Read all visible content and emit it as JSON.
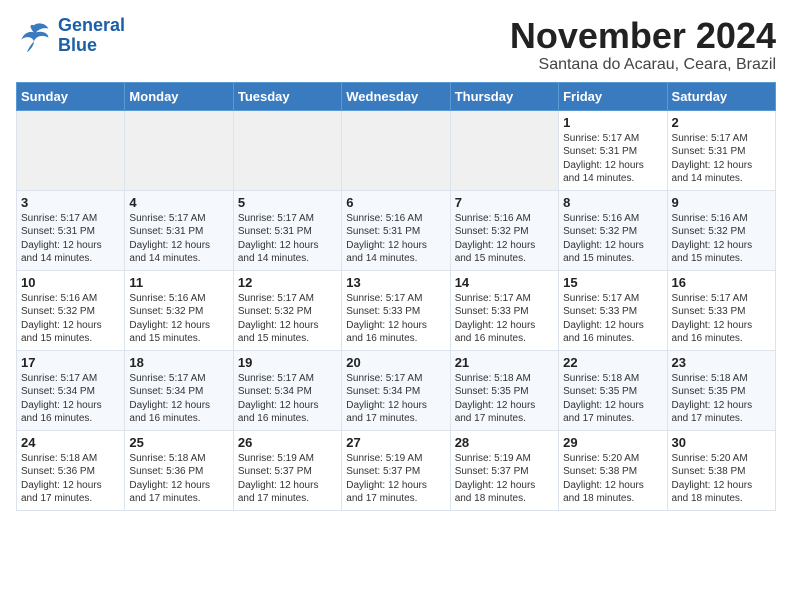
{
  "header": {
    "logo_line1": "General",
    "logo_line2": "Blue",
    "month_title": "November 2024",
    "subtitle": "Santana do Acarau, Ceara, Brazil"
  },
  "weekdays": [
    "Sunday",
    "Monday",
    "Tuesday",
    "Wednesday",
    "Thursday",
    "Friday",
    "Saturday"
  ],
  "weeks": [
    [
      {
        "day": "",
        "info": ""
      },
      {
        "day": "",
        "info": ""
      },
      {
        "day": "",
        "info": ""
      },
      {
        "day": "",
        "info": ""
      },
      {
        "day": "",
        "info": ""
      },
      {
        "day": "1",
        "info": "Sunrise: 5:17 AM\nSunset: 5:31 PM\nDaylight: 12 hours\nand 14 minutes."
      },
      {
        "day": "2",
        "info": "Sunrise: 5:17 AM\nSunset: 5:31 PM\nDaylight: 12 hours\nand 14 minutes."
      }
    ],
    [
      {
        "day": "3",
        "info": "Sunrise: 5:17 AM\nSunset: 5:31 PM\nDaylight: 12 hours\nand 14 minutes."
      },
      {
        "day": "4",
        "info": "Sunrise: 5:17 AM\nSunset: 5:31 PM\nDaylight: 12 hours\nand 14 minutes."
      },
      {
        "day": "5",
        "info": "Sunrise: 5:17 AM\nSunset: 5:31 PM\nDaylight: 12 hours\nand 14 minutes."
      },
      {
        "day": "6",
        "info": "Sunrise: 5:16 AM\nSunset: 5:31 PM\nDaylight: 12 hours\nand 14 minutes."
      },
      {
        "day": "7",
        "info": "Sunrise: 5:16 AM\nSunset: 5:32 PM\nDaylight: 12 hours\nand 15 minutes."
      },
      {
        "day": "8",
        "info": "Sunrise: 5:16 AM\nSunset: 5:32 PM\nDaylight: 12 hours\nand 15 minutes."
      },
      {
        "day": "9",
        "info": "Sunrise: 5:16 AM\nSunset: 5:32 PM\nDaylight: 12 hours\nand 15 minutes."
      }
    ],
    [
      {
        "day": "10",
        "info": "Sunrise: 5:16 AM\nSunset: 5:32 PM\nDaylight: 12 hours\nand 15 minutes."
      },
      {
        "day": "11",
        "info": "Sunrise: 5:16 AM\nSunset: 5:32 PM\nDaylight: 12 hours\nand 15 minutes."
      },
      {
        "day": "12",
        "info": "Sunrise: 5:17 AM\nSunset: 5:32 PM\nDaylight: 12 hours\nand 15 minutes."
      },
      {
        "day": "13",
        "info": "Sunrise: 5:17 AM\nSunset: 5:33 PM\nDaylight: 12 hours\nand 16 minutes."
      },
      {
        "day": "14",
        "info": "Sunrise: 5:17 AM\nSunset: 5:33 PM\nDaylight: 12 hours\nand 16 minutes."
      },
      {
        "day": "15",
        "info": "Sunrise: 5:17 AM\nSunset: 5:33 PM\nDaylight: 12 hours\nand 16 minutes."
      },
      {
        "day": "16",
        "info": "Sunrise: 5:17 AM\nSunset: 5:33 PM\nDaylight: 12 hours\nand 16 minutes."
      }
    ],
    [
      {
        "day": "17",
        "info": "Sunrise: 5:17 AM\nSunset: 5:34 PM\nDaylight: 12 hours\nand 16 minutes."
      },
      {
        "day": "18",
        "info": "Sunrise: 5:17 AM\nSunset: 5:34 PM\nDaylight: 12 hours\nand 16 minutes."
      },
      {
        "day": "19",
        "info": "Sunrise: 5:17 AM\nSunset: 5:34 PM\nDaylight: 12 hours\nand 16 minutes."
      },
      {
        "day": "20",
        "info": "Sunrise: 5:17 AM\nSunset: 5:34 PM\nDaylight: 12 hours\nand 17 minutes."
      },
      {
        "day": "21",
        "info": "Sunrise: 5:18 AM\nSunset: 5:35 PM\nDaylight: 12 hours\nand 17 minutes."
      },
      {
        "day": "22",
        "info": "Sunrise: 5:18 AM\nSunset: 5:35 PM\nDaylight: 12 hours\nand 17 minutes."
      },
      {
        "day": "23",
        "info": "Sunrise: 5:18 AM\nSunset: 5:35 PM\nDaylight: 12 hours\nand 17 minutes."
      }
    ],
    [
      {
        "day": "24",
        "info": "Sunrise: 5:18 AM\nSunset: 5:36 PM\nDaylight: 12 hours\nand 17 minutes."
      },
      {
        "day": "25",
        "info": "Sunrise: 5:18 AM\nSunset: 5:36 PM\nDaylight: 12 hours\nand 17 minutes."
      },
      {
        "day": "26",
        "info": "Sunrise: 5:19 AM\nSunset: 5:37 PM\nDaylight: 12 hours\nand 17 minutes."
      },
      {
        "day": "27",
        "info": "Sunrise: 5:19 AM\nSunset: 5:37 PM\nDaylight: 12 hours\nand 17 minutes."
      },
      {
        "day": "28",
        "info": "Sunrise: 5:19 AM\nSunset: 5:37 PM\nDaylight: 12 hours\nand 18 minutes."
      },
      {
        "day": "29",
        "info": "Sunrise: 5:20 AM\nSunset: 5:38 PM\nDaylight: 12 hours\nand 18 minutes."
      },
      {
        "day": "30",
        "info": "Sunrise: 5:20 AM\nSunset: 5:38 PM\nDaylight: 12 hours\nand 18 minutes."
      }
    ]
  ]
}
